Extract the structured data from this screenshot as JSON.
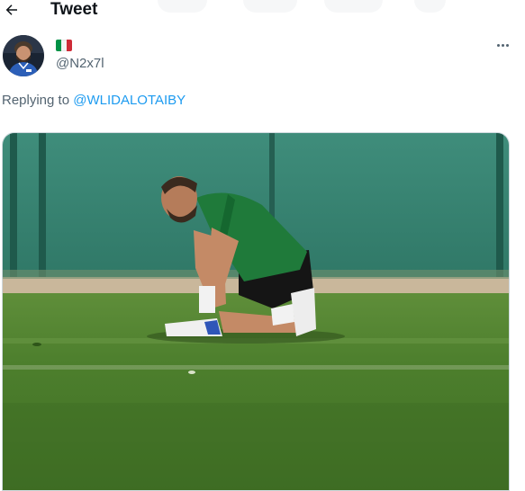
{
  "header": {
    "title": "Tweet",
    "back_icon": "arrow-left-icon"
  },
  "author": {
    "flag": "Italy flag",
    "handle": "@N2x7l",
    "avatar_icon": "avatar",
    "more_icon": "more-horizontal-icon"
  },
  "reply": {
    "prefix": "Replying to ",
    "mention": "@WLIDALOTAIBY"
  },
  "media": {
    "description_icon": "tweet-photo"
  },
  "colors": {
    "accent": "#1d9bf0",
    "secondary_text": "#536471",
    "primary_text": "#0f1419",
    "flag_green": "#009246",
    "flag_white": "#ffffff",
    "flag_red": "#ce2b37"
  }
}
